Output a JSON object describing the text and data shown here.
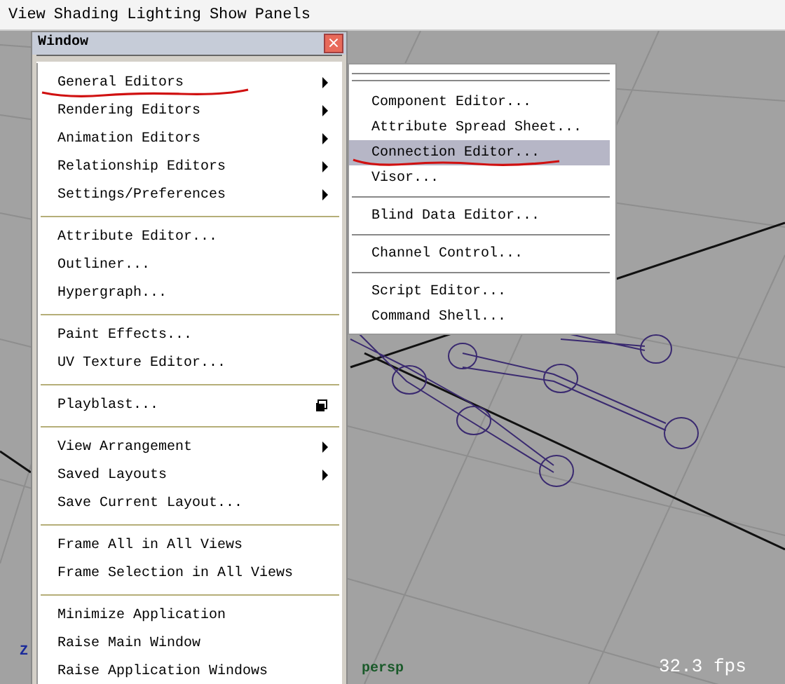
{
  "menu_bar": {
    "items": [
      "View",
      "Shading",
      "Lighting",
      "Show",
      "Panels"
    ]
  },
  "window_menu": {
    "title": "Window",
    "close": "×",
    "groups": [
      [
        {
          "label": "General Editors",
          "kind": "submenu",
          "underlined": true
        },
        {
          "label": "Rendering Editors",
          "kind": "submenu",
          "underlined": false
        },
        {
          "label": "Animation Editors",
          "kind": "submenu",
          "underlined": false
        },
        {
          "label": "Relationship Editors",
          "kind": "submenu",
          "underlined": false
        },
        {
          "label": "Settings/Preferences",
          "kind": "submenu",
          "underlined": false
        }
      ],
      [
        {
          "label": "Attribute Editor...",
          "kind": "plain",
          "underlined": false
        },
        {
          "label": "Outliner...",
          "kind": "plain",
          "underlined": false
        },
        {
          "label": "Hypergraph...",
          "kind": "plain",
          "underlined": false
        }
      ],
      [
        {
          "label": "Paint Effects...",
          "kind": "plain",
          "underlined": false
        },
        {
          "label": "UV Texture Editor...",
          "kind": "plain",
          "underlined": false
        }
      ],
      [
        {
          "label": "Playblast...",
          "kind": "option",
          "underlined": false
        }
      ],
      [
        {
          "label": "View Arrangement",
          "kind": "submenu",
          "underlined": false
        },
        {
          "label": "Saved Layouts",
          "kind": "submenu",
          "underlined": false
        },
        {
          "label": "Save Current Layout...",
          "kind": "plain",
          "underlined": false
        }
      ],
      [
        {
          "label": "Frame All in All Views",
          "kind": "plain",
          "underlined": false
        },
        {
          "label": "Frame Selection in All Views",
          "kind": "plain",
          "underlined": false
        }
      ],
      [
        {
          "label": "Minimize Application",
          "kind": "plain",
          "underlined": false
        },
        {
          "label": "Raise Main Window",
          "kind": "plain",
          "underlined": false
        },
        {
          "label": "Raise Application Windows",
          "kind": "plain",
          "underlined": false
        }
      ]
    ]
  },
  "submenu": {
    "groups": [
      [
        {
          "label": "Component Editor...",
          "selected": false,
          "underlined": false
        },
        {
          "label": "Attribute Spread Sheet...",
          "selected": false,
          "underlined": false
        },
        {
          "label": "Connection Editor...",
          "selected": true,
          "underlined": true
        },
        {
          "label": "Visor...",
          "selected": false,
          "underlined": false
        }
      ],
      [
        {
          "label": "Blind Data Editor...",
          "selected": false,
          "underlined": false
        }
      ],
      [
        {
          "label": "Channel Control...",
          "selected": false,
          "underlined": false
        }
      ],
      [
        {
          "label": "Script Editor...",
          "selected": false,
          "underlined": false
        },
        {
          "label": "Command Shell...",
          "selected": false,
          "underlined": false
        }
      ]
    ]
  },
  "viewport": {
    "axis_label": "Z",
    "camera": "persp",
    "fps": "32.3 fps"
  }
}
